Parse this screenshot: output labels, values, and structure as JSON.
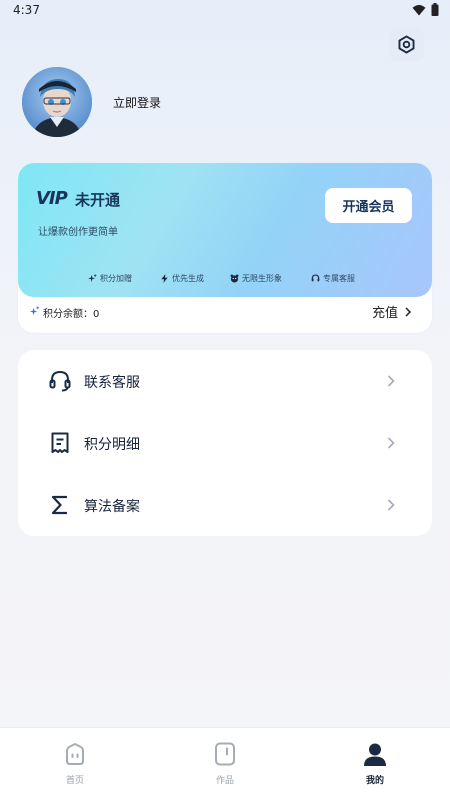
{
  "status_bar": {
    "time": "4:37"
  },
  "profile": {
    "login_label": "立即登录"
  },
  "vip": {
    "logo": "VIP",
    "status": "未开通",
    "tagline": "让爆款创作更简单",
    "open_button": "开通会员",
    "perks": [
      "积分加赠",
      "优先生成",
      "无限生形象",
      "专属客服"
    ]
  },
  "points": {
    "label": "积分余额：0",
    "recharge": "充值"
  },
  "menu": {
    "items": [
      {
        "label": "联系客服",
        "icon": "headset-icon"
      },
      {
        "label": "积分明细",
        "icon": "receipt-icon"
      },
      {
        "label": "算法备案",
        "icon": "sigma-icon"
      }
    ]
  },
  "tabbar": {
    "tabs": [
      {
        "label": "首页",
        "icon": "home-icon",
        "active": false
      },
      {
        "label": "作品",
        "icon": "works-icon",
        "active": false
      },
      {
        "label": "我的",
        "icon": "profile-icon",
        "active": true
      }
    ]
  },
  "colors": {
    "primary_text": "#17355c",
    "card_bg": "#ffffff",
    "page_bg": "#f4f5f9"
  }
}
